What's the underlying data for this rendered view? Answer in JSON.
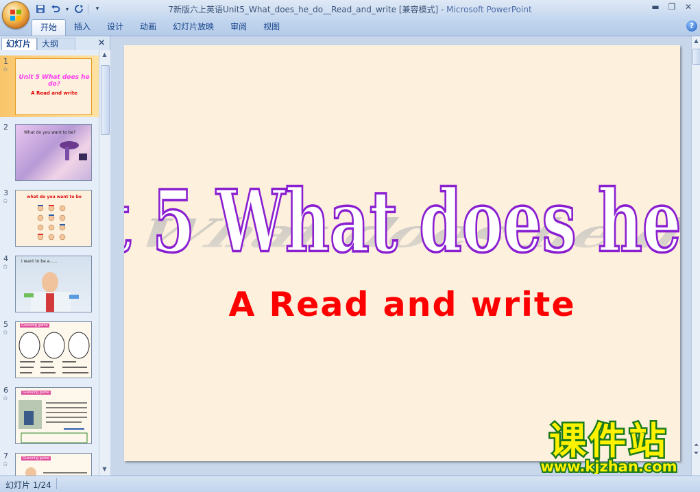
{
  "window": {
    "title": "7新版六上英语Unit5_What_does_he_do__Read_and_write [兼容模式] - ",
    "app_name": "Microsoft PowerPoint"
  },
  "ribbon": {
    "tabs": [
      "开始",
      "插入",
      "设计",
      "动画",
      "幻灯片放映",
      "审阅",
      "视图"
    ],
    "active_tab": "开始"
  },
  "left_pane": {
    "tabs": [
      "幻灯片",
      "大纲"
    ],
    "slides": [
      {
        "num": "1",
        "caption": "Unit 5 What does he do?",
        "sub": "A Read and write"
      },
      {
        "num": "2",
        "caption": "What do you want to be?"
      },
      {
        "num": "3",
        "caption": "what do you want to be"
      },
      {
        "num": "4",
        "caption": "I   want to be a......"
      },
      {
        "num": "5",
        "caption": "Guessing game"
      },
      {
        "num": "6",
        "caption": "Guessing game"
      },
      {
        "num": "7",
        "caption": "Guessing game"
      }
    ]
  },
  "slide": {
    "title": "Unit 5 What does he do?",
    "subtitle": "A Read and write"
  },
  "watermark": {
    "brand": "课件站",
    "url": "www.kjzhan.com"
  },
  "status": {
    "slide_counter": "幻灯片 1/24"
  },
  "colors": {
    "slide_bg": "#fdf0dc",
    "title_outline": "#8a1fd1",
    "subtitle": "#ff0000",
    "watermark_fill": "#fff200",
    "watermark_stroke": "#1c7a1c"
  }
}
